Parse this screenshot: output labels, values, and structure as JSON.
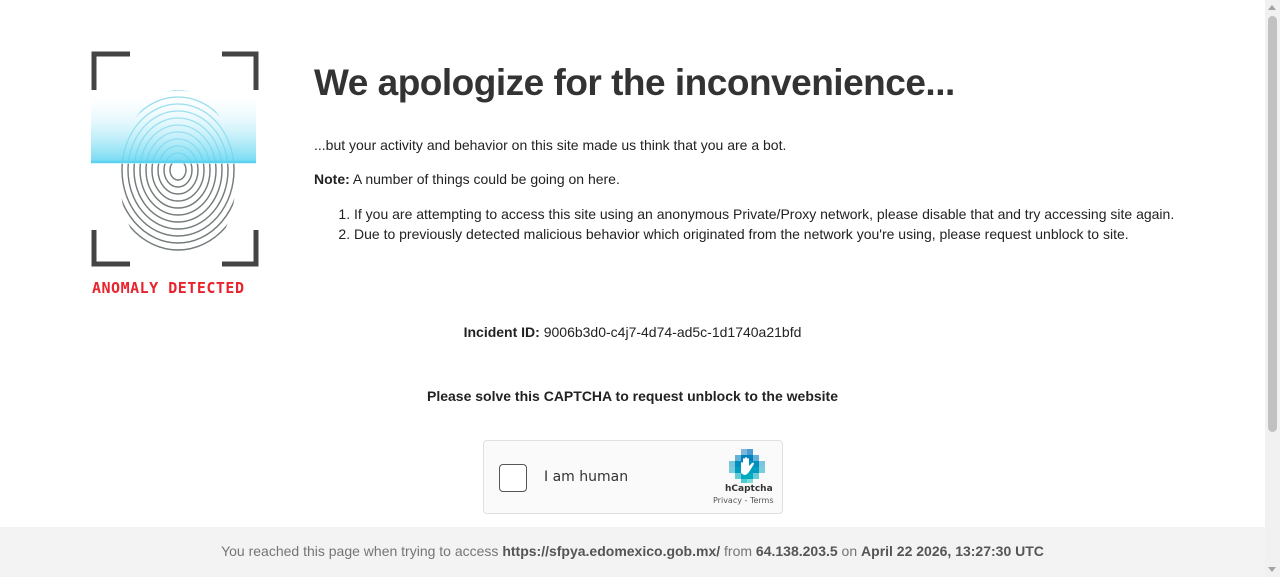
{
  "logo": {
    "caption": "ANOMALY DETECTED",
    "icon": "fingerprint-scan-icon",
    "caption_color": "#e8232d",
    "scan_color": "#5bd3f0"
  },
  "headline": "We apologize for the inconvenience...",
  "intro": "...but your activity and behavior on this site made us think that you are a bot.",
  "note": {
    "label": "Note:",
    "text": " A number of things could be going on here."
  },
  "reasons": [
    "If you are attempting to access this site using an anonymous Private/Proxy network, please disable that and try accessing site again.",
    "Due to previously detected malicious behavior which originated from the network you're using, please request unblock to site."
  ],
  "incident": {
    "label": "Incident ID:",
    "value": " 9006b3d0-c4j7-4d74-ad5c-1d1740a21bfd"
  },
  "captcha_prompt": "Please solve this CAPTCHA to request unblock to the website",
  "captcha": {
    "label": "I am human",
    "brand": "hCaptcha",
    "privacy": "Privacy",
    "separator": " - ",
    "terms": "Terms",
    "logo_icon": "hcaptcha-hand-icon"
  },
  "footer": {
    "prefix": "You reached this page when trying to access ",
    "url": "https://sfpya.edomexico.gob.mx/",
    "from_text": " from ",
    "ip": "64.138.203.5",
    "on_text": " on ",
    "datetime": "April 22 2026, 13:27:30 UTC"
  }
}
